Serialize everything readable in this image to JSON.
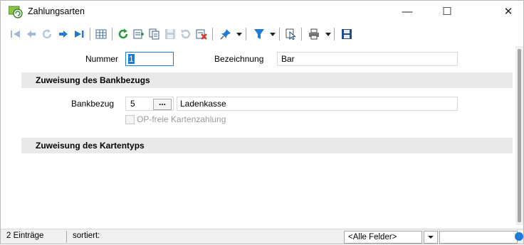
{
  "window": {
    "title": "Zahlungsarten",
    "minimize_glyph": "—",
    "maximize_glyph": "☐",
    "close_glyph": "✕"
  },
  "toolbar": {
    "icons": [
      "first-record-icon",
      "previous-record-icon",
      "refresh-disabled-icon",
      "next-record-icon",
      "last-record-icon",
      "table-view-icon",
      "reload-icon",
      "new-record-icon",
      "copy-record-icon",
      "save-icon",
      "undo-icon",
      "delete-icon",
      "pin-icon",
      "filter-icon",
      "cursor-select-icon",
      "print-icon",
      "save-layout-icon"
    ]
  },
  "form": {
    "nummer_label": "Nummer",
    "nummer_value": "1",
    "bezeichnung_label": "Bezeichnung",
    "bezeichnung_value": "Bar",
    "section_bank": "Zuweisung des Bankbezugs",
    "bankbezug_label": "Bankbezug",
    "bankbezug_value": "5",
    "browse_label": "...",
    "bankbezug_name": "Ladenkasse",
    "op_checkbox_label": "OP-freie Kartenzahlung",
    "op_checkbox_checked": false,
    "section_karten": "Zuweisung des Kartentyps"
  },
  "statusbar": {
    "count": "2 Einträge",
    "sort_label": "sortiert:",
    "field_select": "<Alle Felder>",
    "search_value": ""
  },
  "colors": {
    "accent_blue": "#1e7bd6",
    "refresh_green": "#2e9b3a",
    "delete_red": "#d63a2a",
    "section_bg": "#e9e9e9"
  }
}
